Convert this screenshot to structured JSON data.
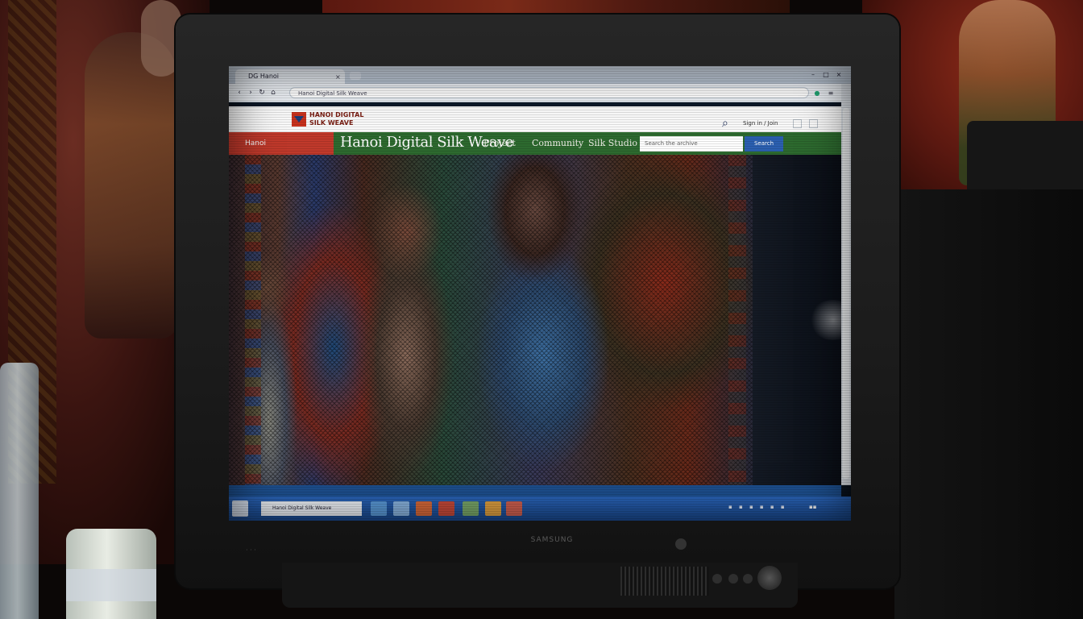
{
  "browser": {
    "tab_title": "DG Hanoi",
    "url": "Hanoi Digital Silk Weave",
    "bookmarks": ""
  },
  "site": {
    "logo_text": "HANOI DIGITAL SILK WEAVE",
    "signin_label": "Sign in / Join",
    "nav": {
      "home_label": "Hanoi",
      "title": "Hanoi Digital Silk Weave",
      "links": [
        "Project",
        "Community",
        "Silk Studio"
      ],
      "search_placeholder": "Search the archive",
      "search_button": "Search"
    }
  },
  "taskbar": {
    "window_label": "Hanoi Digital Silk Weave"
  },
  "monitor": {
    "brand": "SAMSUNG"
  },
  "colors": {
    "nav_green": "#2d6a2f",
    "home_red": "#c0392b",
    "button_blue": "#2b5fb0",
    "taskbar_blue": "#2a64b8"
  },
  "icons": [
    "search-icon",
    "close-icon",
    "back-icon",
    "forward-icon",
    "refresh-icon",
    "home-icon",
    "star-icon",
    "extension-icon",
    "menu-icon",
    "start-icon"
  ]
}
